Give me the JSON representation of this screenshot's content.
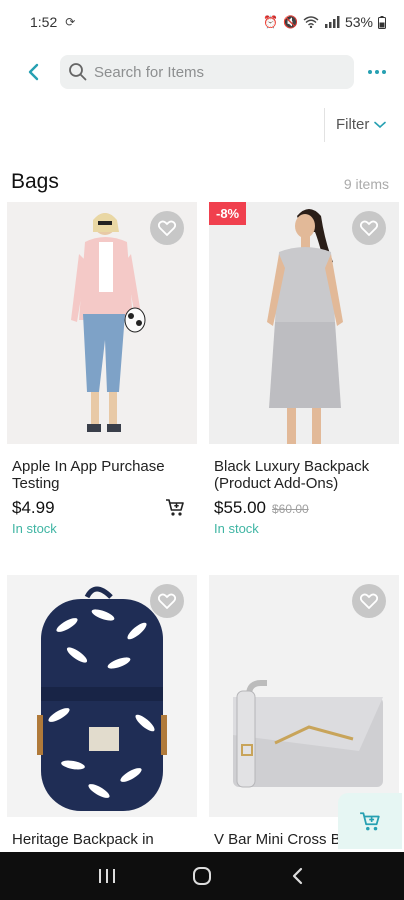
{
  "status_bar": {
    "time": "1:52",
    "battery": "53%"
  },
  "header": {
    "back_icon": "chevron-left-icon",
    "search_placeholder": "Search for Items",
    "more_icon": "more-dots-icon"
  },
  "filter": {
    "label": "Filter"
  },
  "section": {
    "title": "Bags",
    "count": "9 items"
  },
  "products": [
    {
      "title": "Apple In App Purchase Testing",
      "price": "$4.99",
      "old_price": "",
      "stock": "In stock",
      "badge": ""
    },
    {
      "title": "Black Luxury Backpack (Product Add-Ons)",
      "price": "$55.00",
      "old_price": "$60.00",
      "stock": "In stock",
      "badge": "-8%"
    },
    {
      "title": "Heritage Backpack in",
      "price": "",
      "old_price": "",
      "stock": "",
      "badge": ""
    },
    {
      "title": "V Bar Mini Cross B",
      "price": "",
      "old_price": "",
      "stock": "",
      "badge": ""
    }
  ],
  "colors": {
    "accent": "#26a0b2",
    "stock": "#3fb5a3",
    "badge": "#f0404e",
    "nav_bar": "#0e0e0e"
  }
}
